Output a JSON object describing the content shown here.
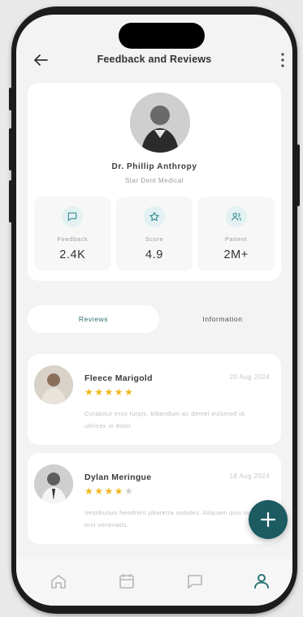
{
  "header": {
    "title": "Feedback and Reviews",
    "back_icon": "arrow-left-icon",
    "menu_icon": "more-vertical-icon"
  },
  "doctor": {
    "name": "Dr. Phillip Anthropy",
    "specialty": "Star Dent Medical"
  },
  "stats": [
    {
      "label": "Feedback",
      "value": "2.4K",
      "icon": "message-square-icon"
    },
    {
      "label": "Score",
      "value": "4.9",
      "icon": "star-icon"
    },
    {
      "label": "Patient",
      "value": "2M+",
      "icon": "users-icon"
    }
  ],
  "tabs": {
    "active": "Reviews",
    "inactive": "Information"
  },
  "reviews": [
    {
      "name": "Fleece Marigold",
      "date": "20 Aug 2024",
      "rating": 5,
      "text": "Curabitur eros turpis, bibendum ac dentel euismod id, ultrices in dolor."
    },
    {
      "name": "Dylan Meringue",
      "date": "18 Aug 2024",
      "rating": 4,
      "text": "Vestibulum hendrerit pharetra sodales. Aliquam quis nulla in orci venenatis."
    }
  ],
  "nav": [
    "home-icon",
    "calendar-icon",
    "chat-icon",
    "profile-icon"
  ],
  "colors": {
    "accent": "#1d5b62",
    "star": "#f1b81e",
    "icon_bg": "#e3f1f2"
  }
}
